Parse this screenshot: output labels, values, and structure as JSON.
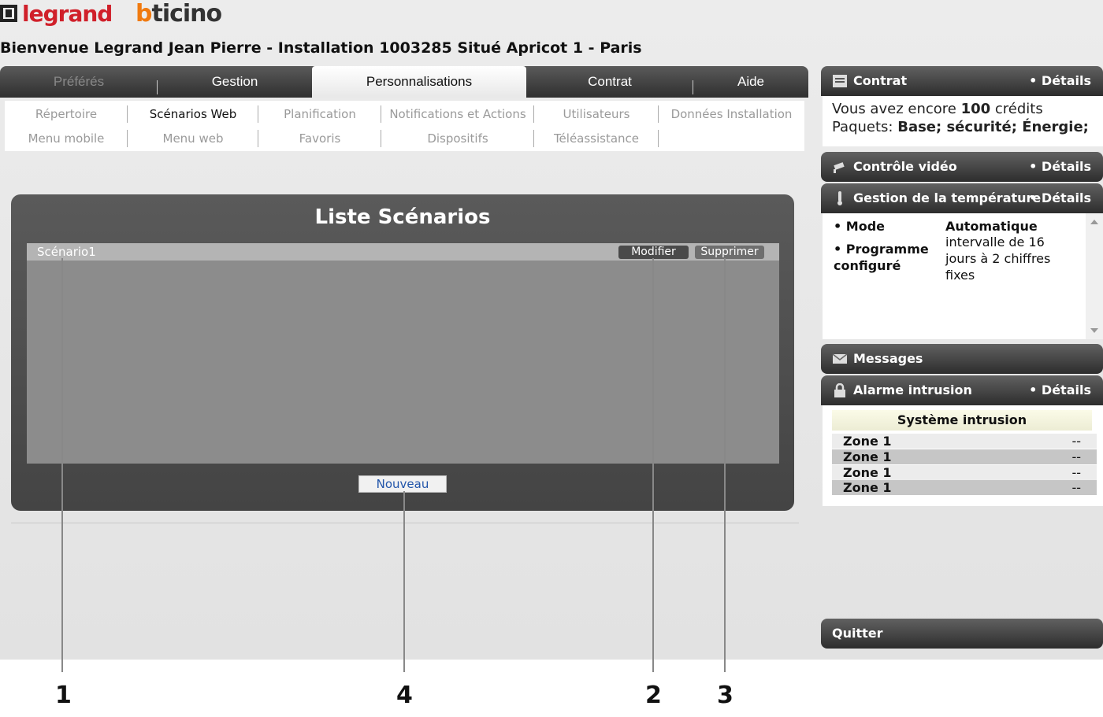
{
  "header": {
    "logo_legrand": "legrand",
    "logo_bticino": "bticino",
    "welcome": "Bienvenue Legrand Jean Pierre - Installation 1003285 Situé Apricot 1 - Paris"
  },
  "tabs": [
    {
      "label": "Préférés",
      "state": "disabled"
    },
    {
      "label": "Gestion",
      "state": "normal"
    },
    {
      "label": "Personnalisations",
      "state": "active"
    },
    {
      "label": "Contrat",
      "state": "normal"
    },
    {
      "label": "Aide",
      "state": "normal"
    }
  ],
  "subnav": {
    "row1": [
      "Répertoire",
      "Scénarios Web",
      "Planification",
      "Notifications et Actions",
      "Utilisateurs",
      "Données Installation"
    ],
    "row2": [
      "Menu mobile",
      "Menu web",
      "Favoris",
      "Dispositifs",
      "Téléassistance"
    ],
    "active": "Scénarios Web"
  },
  "main": {
    "title": "Liste Scénarios",
    "scenarios": [
      {
        "name": "Scénario1",
        "edit_label": "Modifier",
        "delete_label": "Supprimer"
      }
    ],
    "new_label": "Nouveau"
  },
  "sidebar": {
    "details_label": "• Détails",
    "contrat": {
      "title": "Contrat",
      "credits_prefix": "Vous avez encore ",
      "credits_value": "100",
      "credits_suffix": " crédits",
      "packages_label": "Paquets: ",
      "packages_value": "Base; sécurité; Énergie;"
    },
    "video": {
      "title": "Contrôle vidéo"
    },
    "temperature": {
      "title": "Gestion de la température",
      "mode_label": "• Mode",
      "mode_value": "Automatique",
      "program_label_1": "• Programme",
      "program_label_2": "configuré",
      "program_value_1": "intervalle de 16",
      "program_value_2": "jours à 2 chiffres",
      "program_value_3": "fixes"
    },
    "messages": {
      "title": "Messages"
    },
    "alarm": {
      "title": "Alarme intrusion",
      "system_title": "Système intrusion",
      "zones": [
        {
          "name": "Zone 1",
          "value": "--"
        },
        {
          "name": "Zone 1",
          "value": "--"
        },
        {
          "name": "Zone 1",
          "value": "--"
        },
        {
          "name": "Zone 1",
          "value": "--"
        }
      ]
    },
    "quit_label": "Quitter"
  },
  "callouts": [
    "1",
    "4",
    "2",
    "3"
  ]
}
